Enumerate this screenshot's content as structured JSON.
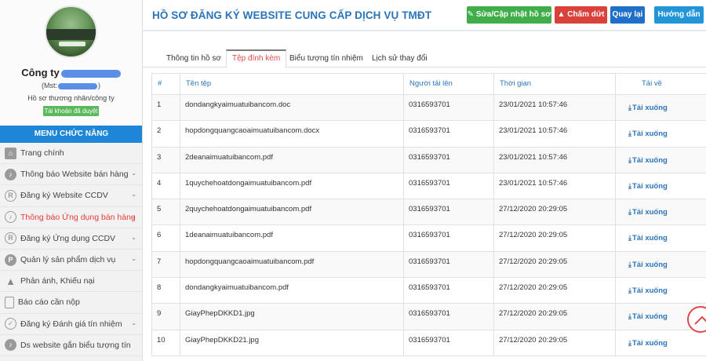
{
  "sidebar": {
    "company_name": "Công ty",
    "mst_prefix": "(Mst:",
    "mst_suffix": ")",
    "profile_type": "Hồ sơ thương nhân/công ty",
    "status_badge": "Tài khoản đã duyệt",
    "menu_title": "MENU CHỨC NĂNG",
    "items": [
      {
        "label": "Trang chính",
        "icon": "home-icon"
      },
      {
        "label": "Thông báo Website bán hàng",
        "icon": "bell-icon"
      },
      {
        "label": "Đăng ký Website CCDV",
        "icon": "registered-icon"
      },
      {
        "label": "Thông báo Ứng dụng bán hàng",
        "icon": "bell-icon"
      },
      {
        "label": "Đăng ký Ứng dụng CCDV",
        "icon": "registered-icon"
      },
      {
        "label": "Quản lý sản phẩm dịch vụ",
        "icon": "parking-icon"
      },
      {
        "label": "Phản ánh, Khiếu nại",
        "icon": "warning-icon"
      },
      {
        "label": "Báo cáo cần nộp",
        "icon": "document-icon"
      },
      {
        "label": "Đăng ký Đánh giá tín nhiệm",
        "icon": "check-circle-icon"
      },
      {
        "label": "Ds website gắn biểu tượng tín",
        "icon": "bell-icon"
      }
    ]
  },
  "header": {
    "title": "HỒ SƠ ĐĂNG KÝ WEBSITE CUNG CẤP DỊCH VỤ TMĐT",
    "edit_label": "Sửa/Cập nhật hồ sơ",
    "stop_label": "Chấm dứt",
    "back_label": "Quay lại",
    "help_label": "Hướng dẫn"
  },
  "tabs": [
    {
      "label": "Thông tin hồ sơ"
    },
    {
      "label": "Tệp đính kèm"
    },
    {
      "label": "Biểu tượng tín nhiệm"
    },
    {
      "label": "Lịch sử thay đổi"
    }
  ],
  "table": {
    "headers": [
      "#",
      "Tên tệp",
      "Người tải lên",
      "Thời gian",
      "Tải về"
    ],
    "download_label": "Tải xuống",
    "rows": [
      {
        "n": "1",
        "file": "dondangkyaimuatuibancom.doc",
        "uploader": "0316593701",
        "time": "23/01/2021 10:57:46"
      },
      {
        "n": "2",
        "file": "hopdongquangcaoaimuatuibancom.docx",
        "uploader": "0316593701",
        "time": "23/01/2021 10:57:46"
      },
      {
        "n": "3",
        "file": "2deanaimuatuibancom.pdf",
        "uploader": "0316593701",
        "time": "23/01/2021 10:57:46"
      },
      {
        "n": "4",
        "file": "1quychehoatdongaimuatuibancom.pdf",
        "uploader": "0316593701",
        "time": "23/01/2021 10:57:46"
      },
      {
        "n": "5",
        "file": "2quychehoatdongaimuatuibancom.pdf",
        "uploader": "0316593701",
        "time": "27/12/2020 20:29:05"
      },
      {
        "n": "6",
        "file": "1deanaimuatuibancom.pdf",
        "uploader": "0316593701",
        "time": "27/12/2020 20:29:05"
      },
      {
        "n": "7",
        "file": "hopdongquangcaoaimuatuibancom.pdf",
        "uploader": "0316593701",
        "time": "27/12/2020 20:29:05"
      },
      {
        "n": "8",
        "file": "dondangkyaimuatuibancom.pdf",
        "uploader": "0316593701",
        "time": "27/12/2020 20:29:05"
      },
      {
        "n": "9",
        "file": "GiayPhepDKKD1.jpg",
        "uploader": "0316593701",
        "time": "27/12/2020 20:29:05"
      },
      {
        "n": "10",
        "file": "GiayPhepDKKD21.jpg",
        "uploader": "0316593701",
        "time": "27/12/2020 20:29:05"
      }
    ]
  },
  "colors": {
    "accent": "#2b74b8",
    "menu_bar": "#1e86d6",
    "active_menu": "#e53b3b",
    "edit_button": "#3fae4a",
    "stop_button": "#d9413a",
    "back_button": "#1f6fc8",
    "help_button": "#2294d8"
  }
}
